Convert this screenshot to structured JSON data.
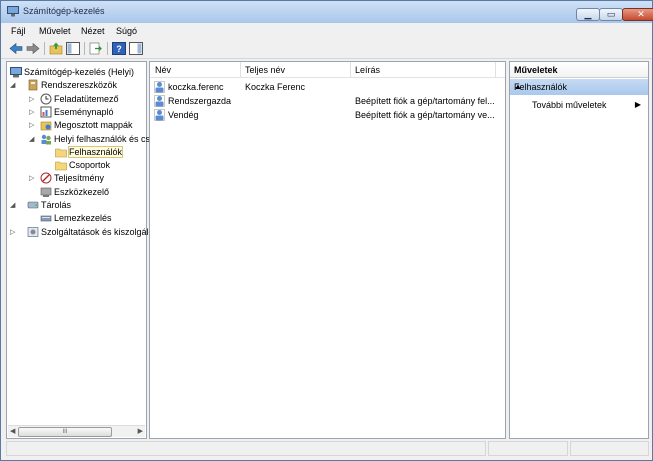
{
  "window": {
    "title": "Számítógép-kezelés"
  },
  "menu": [
    "Fájl",
    "Művelet",
    "Nézet",
    "Súgó"
  ],
  "tree": [
    {
      "label": "Számítógép-kezelés (Helyi)",
      "level": 0,
      "twisty": "",
      "icon": "computer-management-icon"
    },
    {
      "label": "Rendszereszközök",
      "level": 1,
      "twisty": "◢",
      "icon": "system-tools-icon"
    },
    {
      "label": "Feladatütemező",
      "level": 2,
      "twisty": "▷",
      "icon": "task-scheduler-icon"
    },
    {
      "label": "Eseménynapló",
      "level": 2,
      "twisty": "▷",
      "icon": "event-viewer-icon"
    },
    {
      "label": "Megosztott mappák",
      "level": 2,
      "twisty": "▷",
      "icon": "shared-folders-icon"
    },
    {
      "label": "Helyi felhasználók és cs",
      "level": 2,
      "twisty": "◢",
      "icon": "local-users-groups-icon"
    },
    {
      "label": "Felhasználók",
      "level": 3,
      "twisty": "",
      "icon": "folder-icon",
      "selected": true
    },
    {
      "label": "Csoportok",
      "level": 3,
      "twisty": "",
      "icon": "folder-icon"
    },
    {
      "label": "Teljesítmény",
      "level": 2,
      "twisty": "▷",
      "icon": "performance-icon"
    },
    {
      "label": "Eszközkezelő",
      "level": 2,
      "twisty": "",
      "icon": "device-manager-icon"
    },
    {
      "label": "Tárolás",
      "level": 1,
      "twisty": "◢",
      "icon": "storage-icon"
    },
    {
      "label": "Lemezkezelés",
      "level": 2,
      "twisty": "",
      "icon": "disk-management-icon"
    },
    {
      "label": "Szolgáltatások és kiszolgáló",
      "level": 1,
      "twisty": "▷",
      "icon": "services-applications-icon"
    }
  ],
  "list": {
    "columns": [
      "Név",
      "Teljes név",
      "Leírás"
    ],
    "rows": [
      {
        "name": "koczka.ferenc",
        "fullname": "Koczka Ferenc",
        "description": ""
      },
      {
        "name": "Rendszergazda",
        "fullname": "",
        "description": "Beépített fiók a gép/tartomány fel..."
      },
      {
        "name": "Vendég",
        "fullname": "",
        "description": "Beépített fiók a gép/tartomány ve..."
      }
    ]
  },
  "actions": {
    "header": "Műveletek",
    "section": "Felhasználók",
    "more": "További műveletek"
  },
  "scroll": {
    "thumb_label": "III"
  },
  "colors": {
    "accent": "#a9c8ec",
    "selection": "#fffbe0"
  }
}
